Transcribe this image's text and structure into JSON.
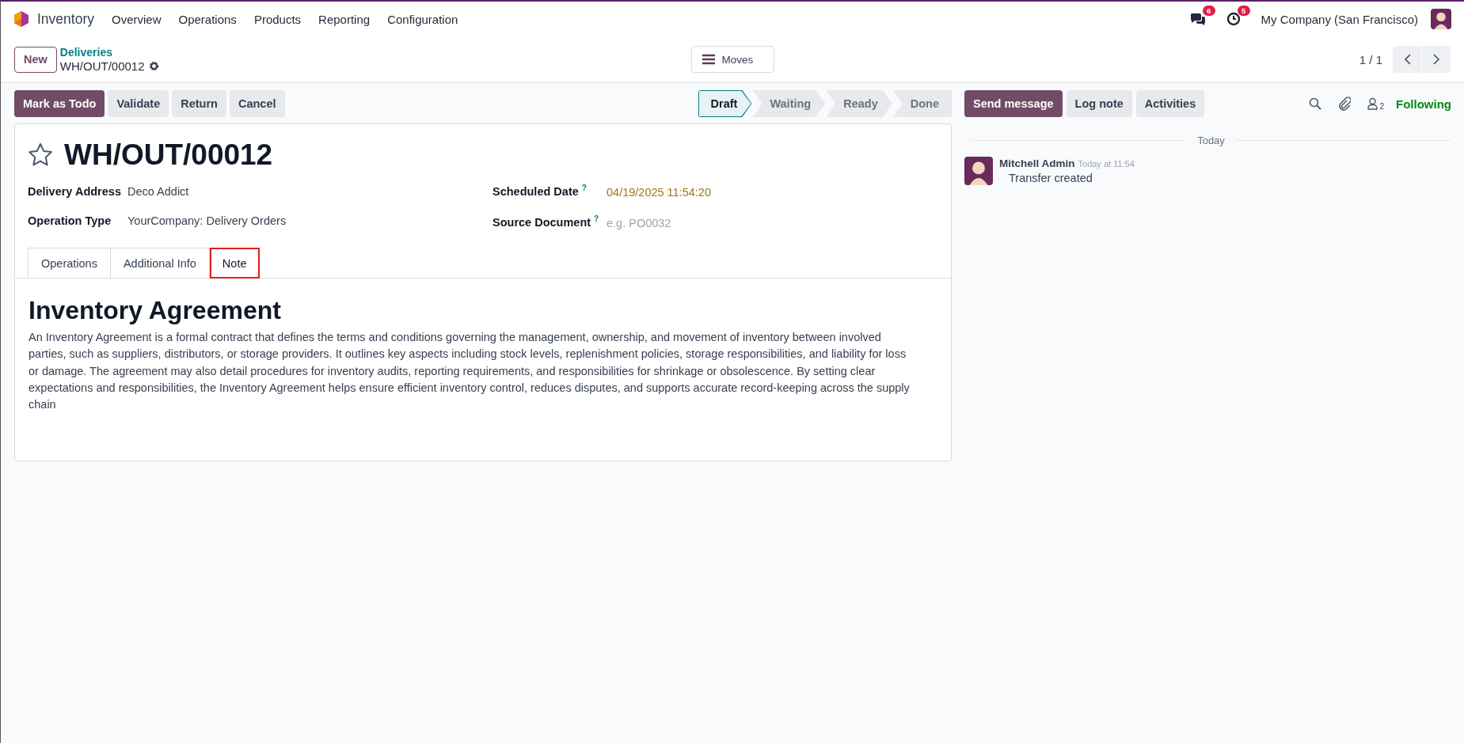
{
  "navbar": {
    "app_name": "Inventory",
    "menu": [
      "Overview",
      "Operations",
      "Products",
      "Reporting",
      "Configuration"
    ],
    "messages_badge": "6",
    "activities_badge": "5",
    "company": "My Company (San Francisco)"
  },
  "control_panel": {
    "new_button": "New",
    "breadcrumb": "Deliveries",
    "record_name": "WH/OUT/00012",
    "view_button": "Moves",
    "pager": "1 / 1"
  },
  "actions": [
    {
      "label": "Mark as Todo",
      "kind": "primary"
    },
    {
      "label": "Validate",
      "kind": "secondary"
    },
    {
      "label": "Return",
      "kind": "secondary"
    },
    {
      "label": "Cancel",
      "kind": "secondary"
    }
  ],
  "statusbar": [
    {
      "label": "Draft",
      "selected": true
    },
    {
      "label": "Waiting",
      "selected": false
    },
    {
      "label": "Ready",
      "selected": false
    },
    {
      "label": "Done",
      "selected": false
    }
  ],
  "form": {
    "favorite": false,
    "title": "WH/OUT/00012",
    "left_fields": [
      {
        "label": "Delivery Address",
        "value": "Deco Addict"
      },
      {
        "label": "Operation Type",
        "value": "YourCompany: Delivery Orders"
      }
    ],
    "right_fields": [
      {
        "label": "Scheduled Date",
        "help": "?",
        "kind": "date",
        "value": "04/19/2025 11:54:20"
      },
      {
        "label": "Source Document",
        "help": "?",
        "kind": "input",
        "placeholder": "e.g. PO0032"
      }
    ],
    "tabs": [
      {
        "label": "Operations",
        "selected": false,
        "annotated": false
      },
      {
        "label": "Additional Info",
        "selected": false,
        "annotated": false
      },
      {
        "label": "Note",
        "selected": true,
        "annotated": true
      }
    ],
    "note": {
      "heading": "Inventory Agreement",
      "body": "An Inventory Agreement is a formal contract that defines the terms and conditions governing the management, ownership, and movement of inventory between involved parties, such as suppliers, distributors, or storage providers. It outlines key aspects including stock levels, replenishment policies, storage responsibilities, and liability for loss or damage. The agreement may also detail procedures for inventory audits, reporting requirements, and responsibilities for shrinkage or obsolescence. By setting clear expectations and responsibilities, the Inventory Agreement helps ensure efficient inventory control, reduces disputes, and supports accurate record-keeping across the supply chain"
    }
  },
  "chatter": {
    "buttons": [
      {
        "label": "Send message",
        "kind": "primary"
      },
      {
        "label": "Log note",
        "kind": "secondary"
      },
      {
        "label": "Activities",
        "kind": "secondary"
      }
    ],
    "followers_count": "2",
    "follow_label": "Following",
    "date_separator": "Today",
    "messages": [
      {
        "author": "Mitchell Admin",
        "time": "Today at 11:54",
        "body": "Transfer created"
      }
    ]
  }
}
